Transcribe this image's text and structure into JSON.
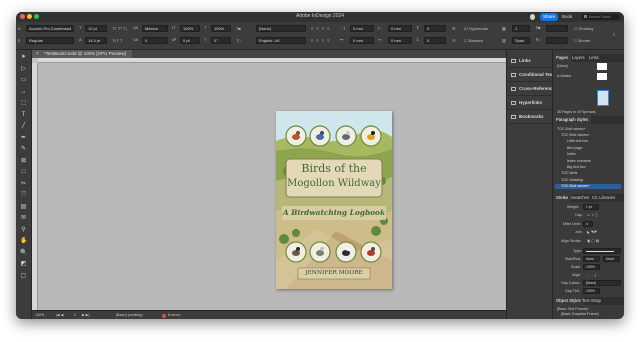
{
  "window": {
    "title": "Adobe InDesign 2024",
    "share_label": "Share",
    "book_label": "Book",
    "search_placeholder": "Adobe Stock",
    "colors": {
      "chrome": "#3c3c3c",
      "dark": "#2a2a2a",
      "accent": "#1473e6",
      "selection": "#2f5f9a"
    }
  },
  "control_bar": {
    "font_family": "Acumin Pro Condensed",
    "font_style": "Regular",
    "font_size": "12 pt",
    "leading": "14.4 pt",
    "kerning": "Metrics",
    "tracking": "0",
    "scale_h": "100%",
    "scale_v": "100%",
    "baseline": "0 pt",
    "skew": "0°",
    "paragraph_style": "[None]",
    "language": "English: UK",
    "indent_left": "0 mm",
    "indent_right": "0 mm",
    "space_before": "0 mm",
    "space_after": "0 mm",
    "hyphenate_label": "Hyphenate",
    "balance_label": "Balance",
    "columns": "1",
    "span_label": "Span"
  },
  "document_tab": {
    "label": "*TestBook2.indd @ 100% [GPU Preview]",
    "close_icon": "x"
  },
  "tools": [
    "selection-tool",
    "direct-selection-tool",
    "page-tool",
    "gap-tool",
    "content-collector-tool",
    "type-tool",
    "line-tool",
    "pen-tool",
    "pencil-tool",
    "rectangle-frame-tool",
    "rectangle-tool",
    "scissors-tool",
    "free-transform-tool",
    "gradient-tool",
    "note-tool",
    "eyedropper-tool",
    "hand-tool",
    "zoom-tool",
    "fill-stroke-swatch",
    "view-mode-button"
  ],
  "cover": {
    "title_line1": "Birds of the",
    "title_line2": "Mogollon Wildway",
    "subtitle": "A Birdwatching Logbook",
    "author": "JENNIFER MOORE",
    "colors": {
      "title": "#3f6a32",
      "label_bg": "#e3d8b8",
      "label_border": "#8b7a4a",
      "sky": "#cfe6ec",
      "hills": "#a7b860",
      "author_bg": "#d9cfa9"
    }
  },
  "status": {
    "zoom": "100%",
    "page": "1",
    "preflight_profile": "[Basic] (working)",
    "errors": "8 errors"
  },
  "mid_panel": {
    "items": [
      {
        "name": "links",
        "label": "Links"
      },
      {
        "name": "conditional-text",
        "label": "Conditional Text"
      },
      {
        "name": "cross-references",
        "label": "Cross-References"
      },
      {
        "name": "hyperlinks",
        "label": "Hyperlinks"
      },
      {
        "name": "bookmarks",
        "label": "Bookmarks"
      }
    ]
  },
  "pages_panel": {
    "tabs": [
      "Pages",
      "Layers",
      "Links"
    ],
    "none_label": "[None]",
    "master_label": "A-Master",
    "footer": "36 Pages in 19 Spreads"
  },
  "paragraph_styles": {
    "tab": "Paragraph Styles",
    "current": "TOC Bird names+",
    "items": [
      {
        "label": "TOC Bird names+",
        "selected": false
      },
      {
        "label": "Little text box",
        "selected": false
      },
      {
        "label": "Bird page",
        "selected": false
      },
      {
        "label": "Index",
        "selected": false
      },
      {
        "label": "Index numbers",
        "selected": false
      },
      {
        "label": "Big text box",
        "selected": false
      },
      {
        "label": "TOC birds",
        "selected": false
      },
      {
        "label": "TOC Heading",
        "selected": false
      },
      {
        "label": "TOC Bird names+",
        "selected": true
      }
    ]
  },
  "stroke_panel": {
    "tabs": [
      "Stroke",
      "Swatches",
      "CC Libraries"
    ],
    "weight_label": "Weight:",
    "weight": "1 pt",
    "cap_label": "Cap:",
    "miter_label": "Miter Limit:",
    "miter": "4",
    "join_label": "Join:",
    "align_label": "Align Stroke:",
    "type_label": "Type:",
    "start_label": "Start/End:",
    "start_value": "None",
    "end_value": "None",
    "scale_label": "Scale:",
    "scale_value": "100%",
    "align2_label": "Align:",
    "gap_color_label": "Gap Colour:",
    "gap_color_value": "[None]",
    "gap_tint_label": "Gap Tint:",
    "gap_tint_value": "100%"
  },
  "object_styles": {
    "tabs": [
      "Object Styles",
      "Text Wrap"
    ],
    "current": "[Basic Text Frame]+",
    "items": [
      {
        "label": "[Basic Graphics Frame]",
        "selected": false
      },
      {
        "label": "[Basic Text Frame]+",
        "selected": true
      }
    ]
  }
}
